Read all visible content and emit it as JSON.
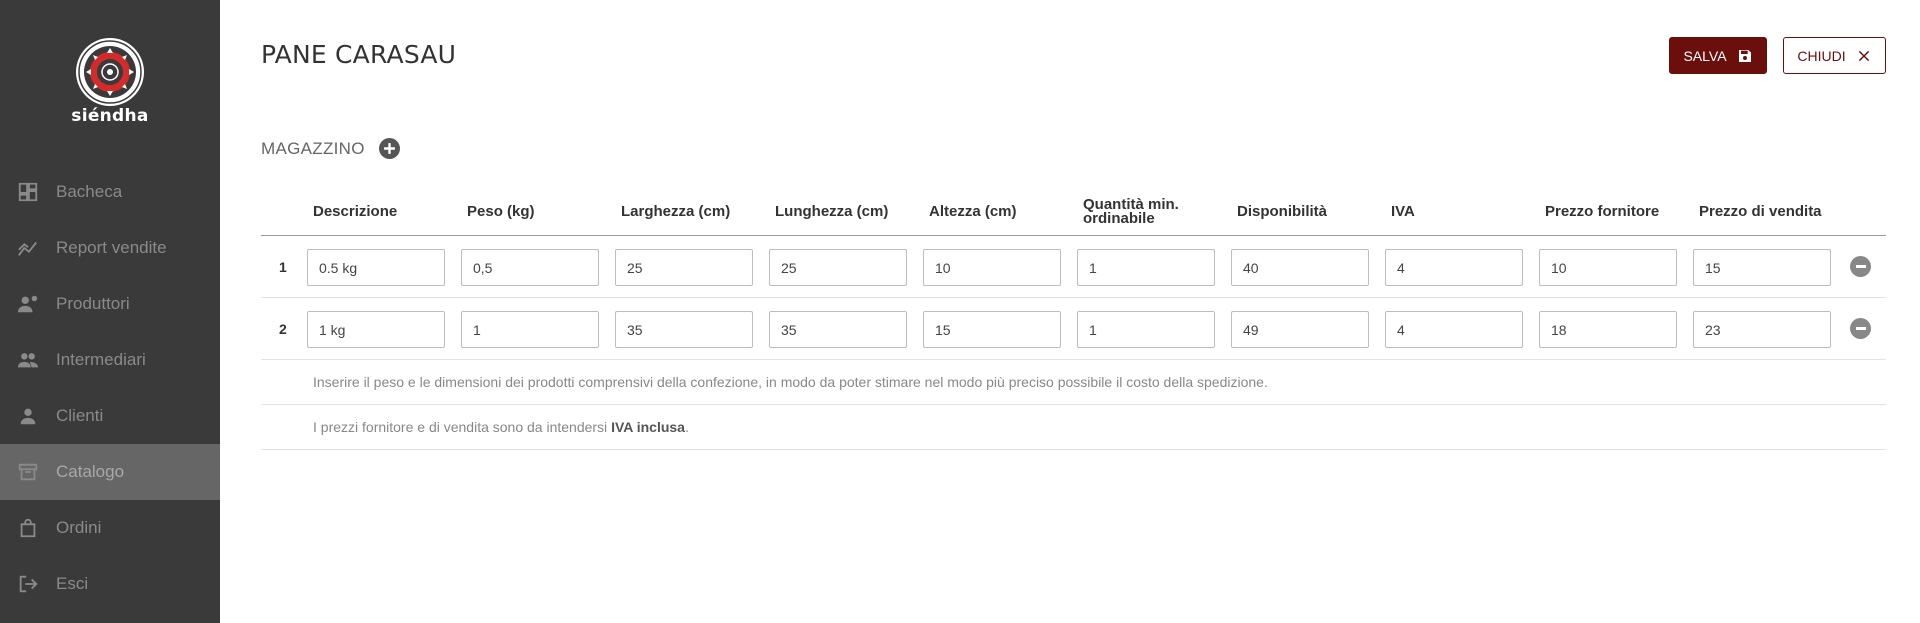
{
  "sidebar": {
    "brand": "siéndha",
    "items": [
      {
        "label": "Bacheca",
        "icon": "dashboard-icon",
        "active": false
      },
      {
        "label": "Report vendite",
        "icon": "chart-icon",
        "active": false
      },
      {
        "label": "Produttori",
        "icon": "producer-icon",
        "active": false
      },
      {
        "label": "Intermediari",
        "icon": "intermediaries-icon",
        "active": false
      },
      {
        "label": "Clienti",
        "icon": "person-icon",
        "active": false
      },
      {
        "label": "Catalogo",
        "icon": "archive-icon",
        "active": true
      },
      {
        "label": "Ordini",
        "icon": "bag-icon",
        "active": false
      },
      {
        "label": "Esci",
        "icon": "logout-icon",
        "active": false
      }
    ]
  },
  "header": {
    "title": "PANE CARASAU",
    "save_label": "SALVA",
    "close_label": "CHIUDI"
  },
  "section": {
    "label": "MAGAZZINO"
  },
  "table": {
    "columns": [
      "Descrizione",
      "Peso (kg)",
      "Larghezza (cm)",
      "Lunghezza (cm)",
      "Altezza (cm)",
      "Quantità min. ordinabile",
      "Disponibilità",
      "IVA",
      "Prezzo fornitore",
      "Prezzo di vendita"
    ],
    "rows": [
      {
        "num": "1",
        "cells": [
          "0.5 kg",
          "0,5",
          "25",
          "25",
          "10",
          "1",
          "40",
          "4",
          "10",
          "15"
        ]
      },
      {
        "num": "2",
        "cells": [
          "1 kg",
          "1",
          "35",
          "35",
          "15",
          "1",
          "49",
          "4",
          "18",
          "23"
        ]
      }
    ],
    "note_1": "Inserire il peso e le dimensioni dei prodotti comprensivi della confezione, in modo da poter stimare nel modo più preciso possibile il costo della spedizione.",
    "note_2_prefix": "I prezzi fornitore e di vendita sono da intendersi ",
    "note_2_bold": "IVA inclusa",
    "note_2_suffix": "."
  },
  "colors": {
    "sidebar_bg": "#3a3a3a",
    "sidebar_active_bg": "#666666",
    "accent": "#6b0f0c",
    "logo_red": "#d42a2a"
  }
}
